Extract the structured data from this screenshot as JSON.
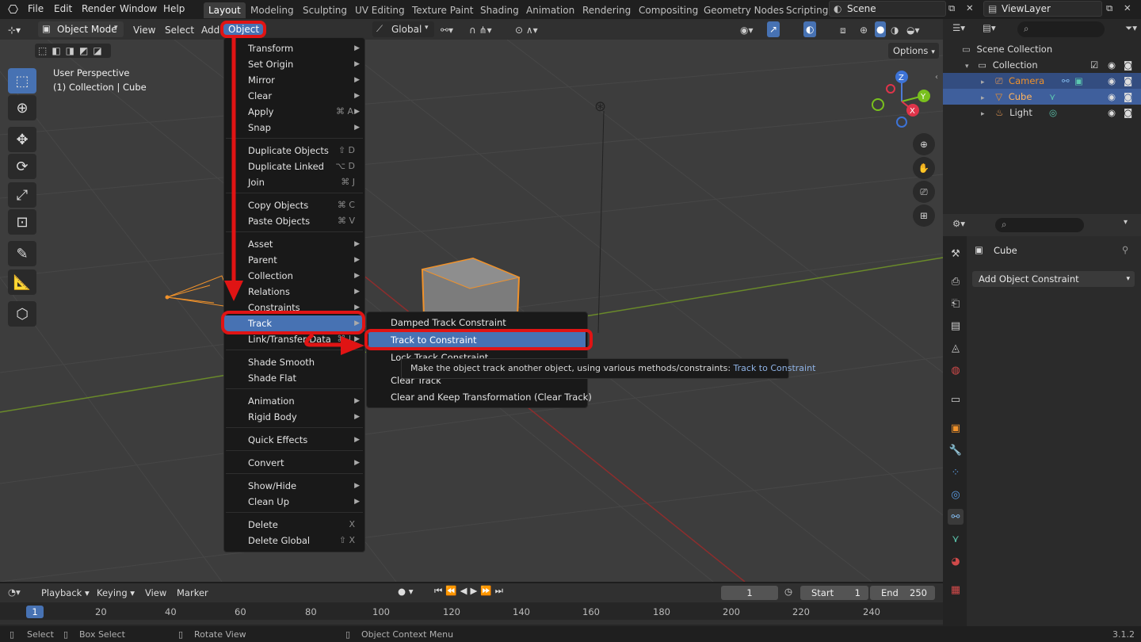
{
  "topbar": {
    "menus": [
      "File",
      "Edit",
      "Render",
      "Window",
      "Help"
    ],
    "workspaces": [
      "Layout",
      "Modeling",
      "Sculpting",
      "UV Editing",
      "Texture Paint",
      "Shading",
      "Animation",
      "Rendering",
      "Compositing",
      "Geometry Nodes",
      "Scripting"
    ],
    "scene": "Scene",
    "view_layer": "ViewLayer"
  },
  "viewport_header": {
    "mode": "Object Mode",
    "menus": [
      "View",
      "Select",
      "Add",
      "Object"
    ],
    "orientation": "Global",
    "options": "Options"
  },
  "viewport": {
    "perspective": "User Perspective",
    "collection_info": "(1) Collection | Cube"
  },
  "object_menu": [
    {
      "label": "Transform",
      "arrow": true
    },
    {
      "label": "Set Origin",
      "arrow": true
    },
    {
      "label": "Mirror",
      "arrow": true
    },
    {
      "label": "Clear",
      "arrow": true
    },
    {
      "label": "Apply",
      "shortcut": "⌘ A",
      "arrow": true
    },
    {
      "label": "Snap",
      "arrow": true
    },
    {
      "label": "Duplicate Objects",
      "shortcut": "⇧ D"
    },
    {
      "label": "Duplicate Linked",
      "shortcut": "⌥ D"
    },
    {
      "label": "Join",
      "shortcut": "⌘ J"
    },
    {
      "label": "Copy Objects",
      "shortcut": "⌘ C"
    },
    {
      "label": "Paste Objects",
      "shortcut": "⌘ V"
    },
    {
      "label": "Asset",
      "arrow": true
    },
    {
      "label": "Parent",
      "arrow": true
    },
    {
      "label": "Collection",
      "arrow": true
    },
    {
      "label": "Relations",
      "arrow": true
    },
    {
      "label": "Constraints",
      "arrow": true
    },
    {
      "label": "Track",
      "arrow": true
    },
    {
      "label": "Link/Transfer Data",
      "shortcut": "⌘ L",
      "arrow": true
    },
    {
      "label": "Shade Smooth"
    },
    {
      "label": "Shade Flat"
    },
    {
      "label": "Animation",
      "arrow": true
    },
    {
      "label": "Rigid Body",
      "arrow": true
    },
    {
      "label": "Quick Effects",
      "arrow": true
    },
    {
      "label": "Convert",
      "arrow": true
    },
    {
      "label": "Show/Hide",
      "arrow": true
    },
    {
      "label": "Clean Up",
      "arrow": true
    },
    {
      "label": "Delete",
      "shortcut": "X"
    },
    {
      "label": "Delete Global",
      "shortcut": "⇧ X"
    }
  ],
  "track_submenu": [
    "Damped Track Constraint",
    "Track to Constraint",
    "Lock Track Constraint",
    "Clear Track",
    "Clear and Keep Transformation (Clear Track)"
  ],
  "tooltip": {
    "text": "Make the object track another object, using various methods/constraints:",
    "python": "Track to Constraint"
  },
  "outliner": {
    "scene_collection": "Scene Collection",
    "collection": "Collection",
    "items": [
      "Camera",
      "Cube",
      "Light"
    ]
  },
  "properties": {
    "object_name": "Cube",
    "add_constraint": "Add Object Constraint"
  },
  "timeline": {
    "menus": [
      "Playback",
      "Keying",
      "View",
      "Marker"
    ],
    "current_frame": "1",
    "start_label": "Start",
    "start": "1",
    "end_label": "End",
    "end": "250",
    "ticks": [
      "1",
      "20",
      "40",
      "60",
      "80",
      "100",
      "120",
      "140",
      "160",
      "180",
      "200",
      "220",
      "240"
    ]
  },
  "status": {
    "select": "Select",
    "box_select": "Box Select",
    "rotate_view": "Rotate View",
    "context_menu": "Object Context Menu",
    "version": "3.1.2"
  },
  "colors": {
    "accent": "#4772b3",
    "annotation_red": "#e01414",
    "selected_orange": "#f0922b"
  }
}
